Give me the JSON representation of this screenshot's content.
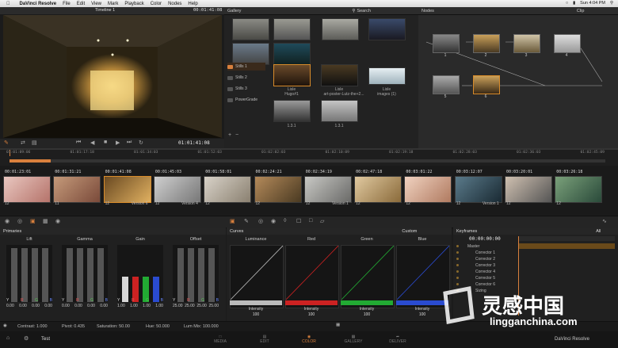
{
  "menubar": {
    "app": "DaVinci Resolve",
    "items": [
      "File",
      "Edit",
      "View",
      "Mark",
      "Playback",
      "Color",
      "Nodes",
      "Help"
    ],
    "clock": "Sun 4:04 PM"
  },
  "viewer": {
    "timeline_name": "Timeline 1",
    "timecode": "00:01:41:08",
    "transport_timecode": "01:01:41:08"
  },
  "gallery": {
    "title": "Gallery",
    "search_label": "Search",
    "albums": [
      "Stills 1",
      "Stills 2",
      "Stills 3",
      "PowerGrade"
    ],
    "stills": [
      {
        "label1": "Lisle",
        "label2": "Hugo#1"
      },
      {
        "label1": "Lisle",
        "label2": "art-poster-Lutz-the+2..."
      },
      {
        "label1": "Lisle",
        "label2": "images (1)"
      },
      {
        "label1": "",
        "label2": "1.3.1"
      },
      {
        "label1": "",
        "label2": "1.3.1"
      }
    ]
  },
  "nodes": {
    "title": "Nodes",
    "clip_label": "Clip",
    "node_labels": [
      "1",
      "2",
      "3",
      "4",
      "5",
      "6"
    ]
  },
  "ruler": {
    "ticks": [
      "01:01:09:06",
      "01:01:17:18",
      "01:01:34:03",
      "01:01:52:03",
      "01:02:02:03",
      "01:02:10:09",
      "01:02:19:18",
      "01:02:28:03",
      "01:02:36:03",
      "01:02:45:09"
    ]
  },
  "clips": [
    {
      "tc": "00:01:23:01",
      "track": "12",
      "version": ""
    },
    {
      "tc": "00:01:31:21",
      "track": "11",
      "version": ""
    },
    {
      "tc": "00:01:41:08",
      "track": "12",
      "version": "Version 6"
    },
    {
      "tc": "00:01:45:03",
      "track": "12",
      "version": "Version 4"
    },
    {
      "tc": "00:01:58:01",
      "track": "12",
      "version": ""
    },
    {
      "tc": "00:02:24:21",
      "track": "12",
      "version": ""
    },
    {
      "tc": "00:02:34:19",
      "track": "12",
      "version": "Version 1"
    },
    {
      "tc": "00:02:47:18",
      "track": "12",
      "version": ""
    },
    {
      "tc": "00:03:01:22",
      "track": "12",
      "version": ""
    },
    {
      "tc": "00:03:12:07",
      "track": "12",
      "version": "Version 1"
    },
    {
      "tc": "00:03:20:01",
      "track": "12",
      "version": ""
    },
    {
      "tc": "00:03:26:18",
      "track": "12",
      "version": ""
    }
  ],
  "primaries": {
    "title": "Primaries",
    "wheels": [
      {
        "name": "Lift",
        "vals": [
          "0.00",
          "0.00",
          "0.00",
          "0.00"
        ]
      },
      {
        "name": "Gamma",
        "vals": [
          "0.00",
          "0.00",
          "0.00",
          "0.00"
        ]
      },
      {
        "name": "Gain",
        "vals": [
          "1.00",
          "1.00",
          "1.00",
          "1.00"
        ]
      },
      {
        "name": "Offset",
        "vals": [
          "25.00",
          "25.00",
          "25.00",
          "25.00"
        ]
      }
    ],
    "channel_labels": [
      "Y",
      "R",
      "G",
      "B"
    ]
  },
  "curves": {
    "title": "Curves",
    "mode": "Custom",
    "channels": [
      {
        "name": "Luminance",
        "intensity_label": "Intensity",
        "intensity": "100",
        "color": "#bbbbbb"
      },
      {
        "name": "Red",
        "intensity_label": "Intensity",
        "intensity": "100",
        "color": "#cc2222"
      },
      {
        "name": "Green",
        "intensity_label": "Intensity",
        "intensity": "100",
        "color": "#22aa33"
      },
      {
        "name": "Blue",
        "intensity_label": "Intensity",
        "intensity": "100",
        "color": "#2a4bd0"
      }
    ]
  },
  "keyframes": {
    "title": "Keyframes",
    "filter": "All",
    "timecode": "00:00:00:00",
    "rows": [
      "Master",
      "Corrector 1",
      "Corrector 2",
      "Corrector 3",
      "Corrector 4",
      "Corrector 5",
      "Corrector 6",
      "Sizing"
    ]
  },
  "status": {
    "contrast": "Contrast: 1.000",
    "pivot": "Pivot: 0.435",
    "saturation": "Saturation: 50.00",
    "hue": "Hue: 50.000",
    "lum_mix": "Lum Mix: 100.000"
  },
  "pages": {
    "project": "Test",
    "tabs": [
      "MEDIA",
      "EDIT",
      "COLOR",
      "GALLERY",
      "DELIVER"
    ],
    "active": "COLOR"
  },
  "footer_brand": "DaVinci Resolve",
  "watermark": {
    "logo_text": "灵感中国",
    "url": "lingganchina.com"
  },
  "colors": {
    "accent": "#d9803d",
    "selection": "#d88b2a"
  }
}
